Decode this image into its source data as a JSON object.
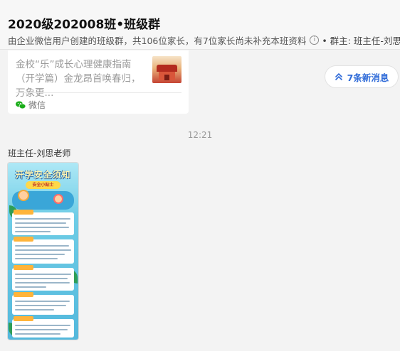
{
  "header": {
    "title": "2020级202008班•班级群",
    "subtitle": "由企业微信用户创建的班级群，共106位家长，有7位家长尚未补充本班资料",
    "info_icon_glyph": "i",
    "owner": "• 群主: 班主任-刘思老师"
  },
  "link_card": {
    "text": "金校“乐”成长心理健康指南（开学篇）金龙昂首唤春归，万象更...",
    "source": "微信",
    "source_icon": "wechat-icon",
    "source_color": "#1aad19"
  },
  "new_messages": {
    "label": "7条新消息",
    "icon": "chevron-up-icon",
    "color": "#2f6bd8"
  },
  "chat": {
    "timestamp": "12:21",
    "sender": "班主任-刘思老师"
  },
  "poster": {
    "title": "开学安全须知",
    "subtitle": "安全小贴士"
  }
}
